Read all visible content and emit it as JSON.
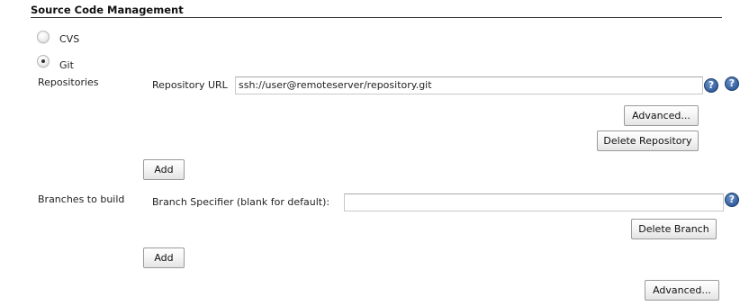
{
  "section": {
    "title": "Source Code Management"
  },
  "scm_options": {
    "cvs_label": "CVS",
    "git_label": "Git",
    "selected": "Git"
  },
  "repositories": {
    "label": "Repositories",
    "url_label": "Repository URL",
    "url_value": "ssh://user@remoteserver/repository.git",
    "advanced_button": "Advanced...",
    "delete_button": "Delete Repository",
    "add_button": "Add"
  },
  "branches": {
    "label": "Branches to build",
    "specifier_label": "Branch Specifier (blank for default):",
    "specifier_value": "",
    "delete_button": "Delete Branch",
    "add_button": "Add"
  },
  "footer": {
    "advanced_button": "Advanced..."
  },
  "icons": {
    "help": "?",
    "help_icon_name": "help-icon"
  },
  "colors": {
    "help_icon": "#345f9e",
    "rule": "#333333"
  }
}
